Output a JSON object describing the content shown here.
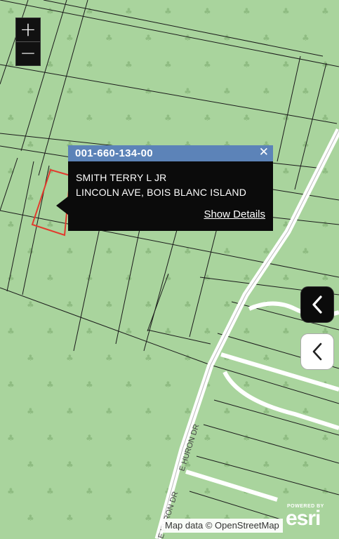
{
  "map": {
    "road_label": "E HURON DR",
    "road_label_bottom": "E HURON DR",
    "tree_symbol": "♣"
  },
  "zoom": {
    "in_label": "+",
    "out_label": "−"
  },
  "popup": {
    "parcel_id": "001-660-134-00",
    "close_symbol": "✕",
    "owner": "SMITH TERRY L JR",
    "address": "LINCOLN AVE, BOIS BLANC ISLAND",
    "details_link": "Show Details"
  },
  "attribution": "Map data © OpenStreetMap",
  "esri": {
    "powered": "POWERED BY",
    "logo": "esri"
  },
  "colors": {
    "map_bg": "#a9d49d",
    "parcel_line": "#1a1a1a",
    "selected_parcel": "#e23b2e",
    "popup_header": "#5c83b8",
    "popup_body": "#0b0b0b",
    "road": "#ffffff"
  }
}
